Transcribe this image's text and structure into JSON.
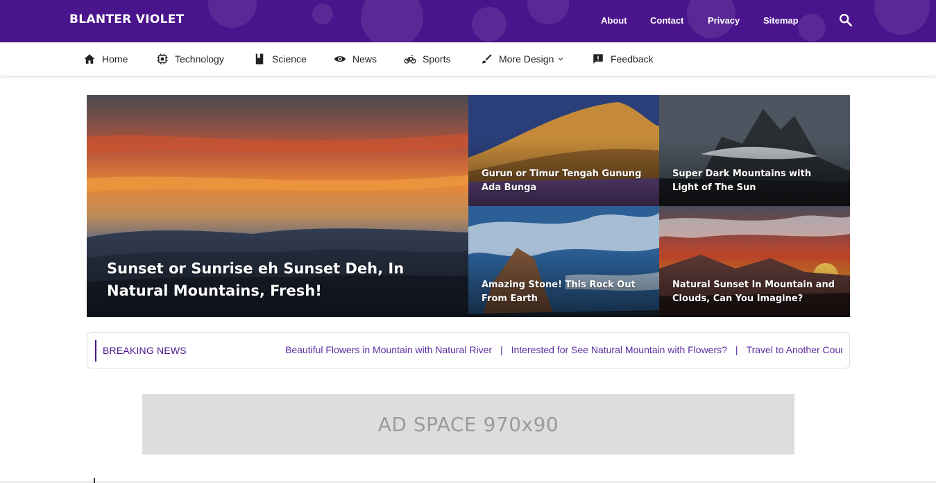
{
  "header": {
    "site_title": "BLANTER VIOLET",
    "links": [
      "About",
      "Contact",
      "Privacy",
      "Sitemap"
    ],
    "search_icon": "search-icon",
    "brand_color": "#4a148c"
  },
  "nav": {
    "items": [
      {
        "label": "Home",
        "icon": "home-icon"
      },
      {
        "label": "Technology",
        "icon": "chip-icon"
      },
      {
        "label": "Science",
        "icon": "book-icon"
      },
      {
        "label": "News",
        "icon": "eye-icon"
      },
      {
        "label": "Sports",
        "icon": "bicycle-icon"
      },
      {
        "label": "More Design",
        "icon": "brush-icon",
        "dropdown": true
      },
      {
        "label": "Feedback",
        "icon": "feedback-icon"
      }
    ]
  },
  "featured": {
    "main": {
      "title": "Sunset or Sunrise eh Sunset Deh, In Natural Mountains, Fresh!"
    },
    "posts": [
      {
        "title": "Gurun or Timur Tengah Gunung Ada Bunga"
      },
      {
        "title": "Super Dark Mountains with Light of The Sun"
      },
      {
        "title": "Amazing Stone! This Rock Out From Earth"
      },
      {
        "title": "Natural Sunset In Mountain and Clouds, Can You Imagine?"
      }
    ]
  },
  "breaking": {
    "label": "BREAKING NEWS",
    "items": [
      "Beautiful Flowers in Mountain with Natural River",
      "Interested for See Natural Mountain with Flowers?",
      "Travel to Another Country"
    ],
    "separator": "|"
  },
  "ad": {
    "text": "AD SPACE 970x90"
  }
}
